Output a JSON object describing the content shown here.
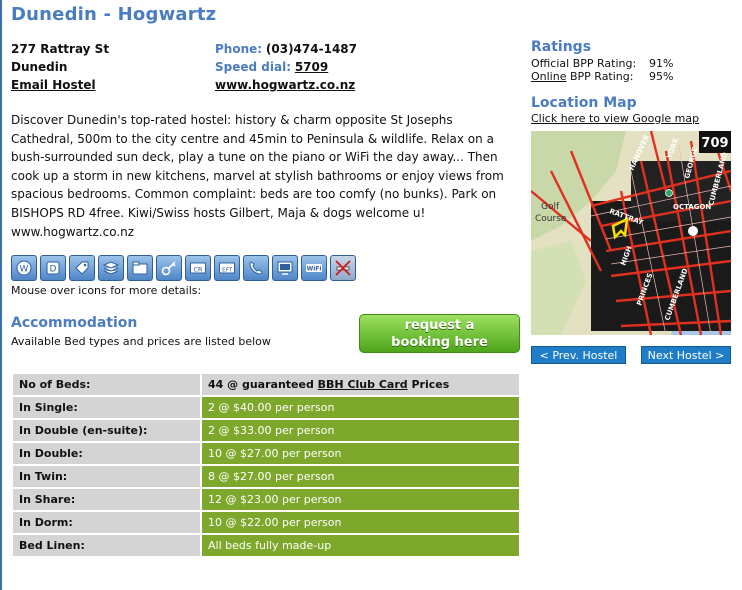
{
  "hostel": {
    "title": "Dunedin - Hogwartz"
  },
  "address": {
    "street": "277 Rattray St",
    "city": "Dunedin",
    "email_link": "Email Hostel"
  },
  "contact": {
    "phone_label": "Phone:",
    "phone": "(03)474-1487",
    "speed_label": "Speed dial:",
    "speed": "5709",
    "website": "www.hogwartz.co.nz"
  },
  "description": "Discover Dunedin's top-rated hostel: history & charm opposite St Josephs Cathedral, 500m to the city centre and 45min to Peninsula & wildlife. Relax on a bush-surrounded sun deck, play a tune on the piano or WiFi the day away... Then cook up a storm in new kitchens, marvel at stylish bathrooms or enjoy views from spacious bedrooms. Common complaint: beds are too comfy (no bunks). Park on BISHOPS RD 4free. Kiwi/Swiss hosts Gilbert, Maja & dogs welcome u! www.hogwartz.co.nz",
  "icons": {
    "items": [
      "w-icon",
      "d-icon",
      "tag-icon",
      "stack-icon",
      "folders-icon",
      "key-icon",
      "cr-card-icon",
      "eftpos-icon",
      "phone-icon",
      "tv-icon",
      "wifi-icon",
      "no-smoking-icon"
    ],
    "cr_text": "CR",
    "eft_text": "EFT",
    "wifi_text": "WiFi",
    "note": "Mouse over icons for more details:"
  },
  "accommodation": {
    "title": "Accommodation",
    "subtitle": "Available Bed types and prices are listed below",
    "book_line1": "request a",
    "book_line2": "booking here"
  },
  "beds": {
    "header_label": "No of Beds:",
    "header_prefix": "44 @ guaranteed ",
    "header_link": "BBH Club Card",
    "header_suffix": " Prices",
    "rows": [
      {
        "label": "In Single:",
        "value": "2 @ $40.00 per person"
      },
      {
        "label": "In Double (en-suite):",
        "value": "2 @ $33.00 per person"
      },
      {
        "label": "In Double:",
        "value": "10 @ $27.00 per person"
      },
      {
        "label": "In Twin:",
        "value": "8 @ $27.00 per person"
      },
      {
        "label": "In Share:",
        "value": "12 @ $23.00 per person"
      },
      {
        "label": "In Dorm:",
        "value": "10 @ $22.00 per person"
      },
      {
        "label": "Bed Linen:",
        "value": "All beds fully made-up"
      }
    ]
  },
  "ratings": {
    "title": "Ratings",
    "official_label": "Official BPP Rating:",
    "official_value": "91%",
    "online_link": "Online",
    "online_label": " BPP Rating:",
    "online_value": "95%"
  },
  "location": {
    "title": "Location Map",
    "link": "Click here to view Google map",
    "map_number": "709",
    "streets": [
      "HANOVER",
      "YORK",
      "GEORGE",
      "CUMBERLAND",
      "Golf",
      "Course",
      "RATTRAY",
      "OCTAGON",
      "HIGH",
      "PRINCES",
      "CUMBERLAND"
    ]
  },
  "nav": {
    "prev": "< Prev. Hostel",
    "next": "Next Hostel >"
  }
}
